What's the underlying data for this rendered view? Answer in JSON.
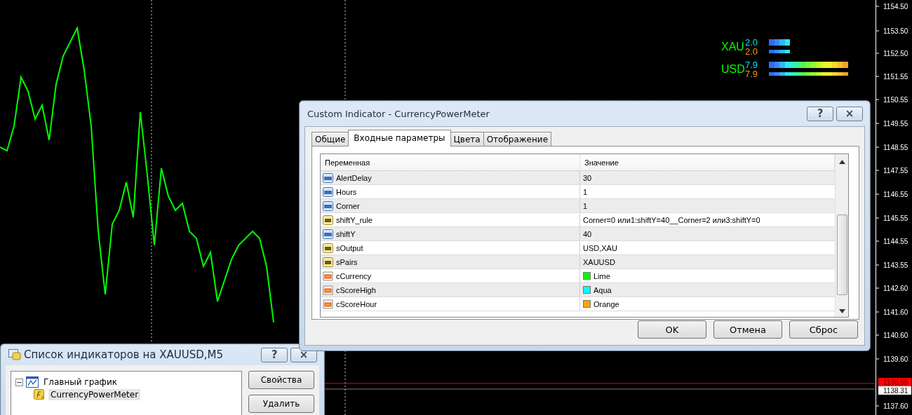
{
  "price_axis": {
    "labels": [
      "1154.50",
      "1153.50",
      "1152.50",
      "1151.55",
      "1150.55",
      "1149.55",
      "1148.55",
      "1147.55",
      "1146.55",
      "1145.55",
      "1144.55",
      "1143.55",
      "1142.60",
      "1141.60",
      "1140.60",
      "1139.60",
      "1137.60"
    ],
    "markers": [
      {
        "label": "1138.55",
        "color": "#ff0000"
      },
      {
        "label": "1138.31",
        "color": "#ffffff"
      }
    ]
  },
  "meter": [
    {
      "currency": "XAU",
      "readings": [
        {
          "kind": "high",
          "text": "2.0"
        },
        {
          "kind": "hour",
          "text": "2.0"
        }
      ]
    },
    {
      "currency": "USD",
      "readings": [
        {
          "kind": "high",
          "text": "7.9"
        },
        {
          "kind": "hour",
          "text": "7.9"
        }
      ]
    }
  ],
  "indicator_dialog": {
    "title": "Custom Indicator - CurrencyPowerMeter",
    "help": "?",
    "close": "×",
    "tabs": [
      {
        "label": "Общие",
        "selected": false
      },
      {
        "label": "Входные параметры",
        "selected": true
      },
      {
        "label": "Цвета",
        "selected": false
      },
      {
        "label": "Отображение",
        "selected": false
      }
    ],
    "table": {
      "columns": [
        "Переменная",
        "Значение"
      ],
      "rows": [
        {
          "kind": "int",
          "name": "AlertDelay",
          "value": "30"
        },
        {
          "kind": "int",
          "name": "Hours",
          "value": "1"
        },
        {
          "kind": "int",
          "name": "Corner",
          "value": "1"
        },
        {
          "kind": "string",
          "name": "shiftY_rule",
          "value": "Corner=0 или1:shiftY=40__Corner=2 или3:shiftY=0"
        },
        {
          "kind": "int",
          "name": "shiftY",
          "value": "40"
        },
        {
          "kind": "string",
          "name": "sOutput",
          "value": "USD,XAU"
        },
        {
          "kind": "string",
          "name": "sPairs",
          "value": "XAUUSD"
        },
        {
          "kind": "color",
          "name": "cCurrency",
          "value": "Lime",
          "color": "#00ff00"
        },
        {
          "kind": "color",
          "name": "cScoreHigh",
          "value": "Aqua",
          "color": "#00ffff"
        },
        {
          "kind": "color",
          "name": "cScoreHour",
          "value": "Orange",
          "color": "#ffa500"
        }
      ]
    },
    "buttons": [
      "OK",
      "Отмена",
      "Сброс"
    ]
  },
  "list_dialog": {
    "title": "Список индикаторов на XAUUSD,M5",
    "help": "?",
    "close": "×",
    "tree": [
      {
        "label": "Главный график",
        "expanded": true,
        "selected": false,
        "children": [
          {
            "label": "CurrencyPowerMeter",
            "selected": true
          }
        ]
      }
    ],
    "buttons": [
      "Свойства",
      "Удалить"
    ]
  }
}
